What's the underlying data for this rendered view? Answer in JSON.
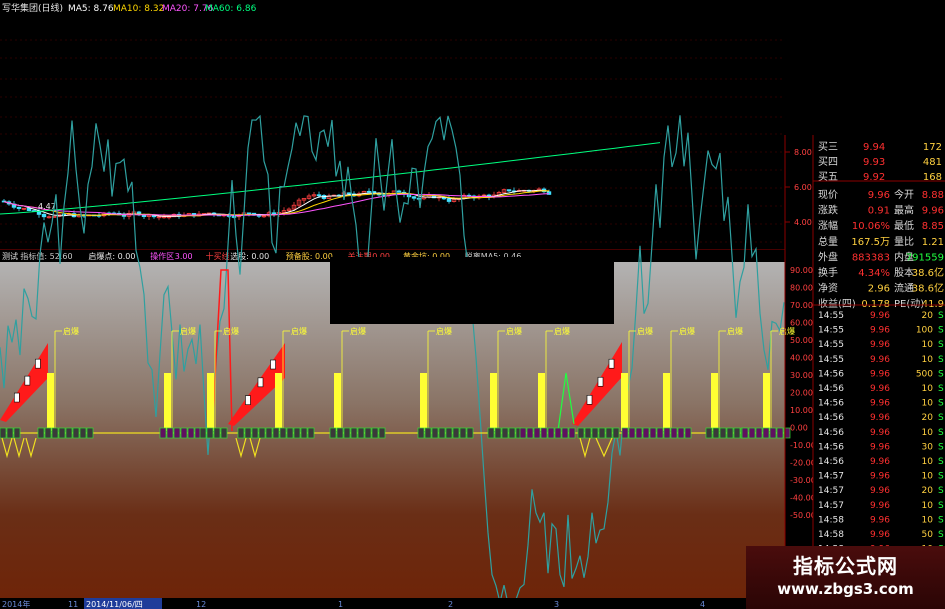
{
  "main_header": {
    "title": "写华集团(日线)",
    "ma5": "MA5: 8.76",
    "ma10": "MA10: 8.32",
    "ma20": "MA20: 7.76",
    "ma60": "MA60: 6.86"
  },
  "price_axis": [
    "8.00",
    "6.00",
    "4.00"
  ],
  "low_label": "4.47",
  "ind_header": [
    {
      "text": "测试",
      "color": "#e6e6e6"
    },
    {
      "text": "指标值: 52.60",
      "color": "#c8c8c8"
    },
    {
      "text": "启爆点: 0.00",
      "color": "#e6e6e6"
    },
    {
      "text": "操作区",
      "color": "#ff55ff"
    },
    {
      "text": "3.00",
      "color": "#ff55ff"
    },
    {
      "text": "十买线",
      "color": "#ff4040"
    },
    {
      "text": "选股: 0.00",
      "color": "#e6e6e6"
    },
    {
      "text": "预备股: 0.00",
      "color": "#ffd040"
    },
    {
      "text": "关注期",
      "color": "#ff4040"
    },
    {
      "text": "0.00",
      "color": "#ff4040"
    },
    {
      "text": "黄金坑: 0.00",
      "color": "#ffd040"
    },
    {
      "text": "脱离MA5: 0.46",
      "color": "#c8c8c8"
    }
  ],
  "ind_axis": [
    "90.00",
    "80.00",
    "70.00",
    "60.00",
    "50.00",
    "40.00",
    "30.00",
    "20.00",
    "10.00",
    "0.00",
    "-10.00",
    "-20.00",
    "-30.00",
    "-40.00",
    "-50.00"
  ],
  "signal_label": "启爆",
  "signal_x": [
    50,
    167,
    210,
    278,
    337,
    423,
    493,
    541,
    624,
    666,
    714,
    766
  ],
  "date_bar": [
    "2014年",
    "11",
    "2014/11/06/四",
    "12",
    "1",
    "2",
    "3",
    "4"
  ],
  "order_book": [
    {
      "label": "买三",
      "price": "9.94",
      "vol": "172"
    },
    {
      "label": "买四",
      "price": "9.93",
      "vol": "481"
    },
    {
      "label": "买五",
      "price": "9.92",
      "vol": "168"
    }
  ],
  "quote_rows": [
    {
      "l": "现价",
      "v": "9.96",
      "r": "今开",
      "rv": "8.88"
    },
    {
      "l": "涨跌",
      "v": "0.91",
      "r": "最高",
      "rv": "9.96"
    },
    {
      "l": "涨幅",
      "v": "10.06%",
      "r": "最低",
      "rv": "8.85"
    },
    {
      "l": "总量",
      "v": "167.5万",
      "r": "量比",
      "rv": "1.21"
    },
    {
      "l": "外盘",
      "v": "883383",
      "r": "内盘",
      "rv": "791559"
    },
    {
      "l": "换手",
      "v": "4.34%",
      "r": "股本",
      "rv": "38.6亿"
    },
    {
      "l": "净资",
      "v": "2.96",
      "r": "流通",
      "rv": "38.6亿"
    },
    {
      "l": "收益(四)",
      "v": "0.178",
      "r": "PE(动)",
      "rv": "41.9"
    }
  ],
  "ticks": [
    {
      "t": "14:55",
      "p": "9.96",
      "v": "20",
      "f": "S"
    },
    {
      "t": "14:55",
      "p": "9.96",
      "v": "100",
      "f": "S"
    },
    {
      "t": "14:55",
      "p": "9.96",
      "v": "10",
      "f": "S"
    },
    {
      "t": "14:55",
      "p": "9.96",
      "v": "10",
      "f": "S"
    },
    {
      "t": "14:56",
      "p": "9.96",
      "v": "500",
      "f": "S"
    },
    {
      "t": "14:56",
      "p": "9.96",
      "v": "10",
      "f": "S"
    },
    {
      "t": "14:56",
      "p": "9.96",
      "v": "10",
      "f": "S"
    },
    {
      "t": "14:56",
      "p": "9.96",
      "v": "20",
      "f": "S"
    },
    {
      "t": "14:56",
      "p": "9.96",
      "v": "10",
      "f": "S"
    },
    {
      "t": "14:56",
      "p": "9.96",
      "v": "30",
      "f": "S"
    },
    {
      "t": "14:56",
      "p": "9.96",
      "v": "10",
      "f": "S"
    },
    {
      "t": "14:57",
      "p": "9.96",
      "v": "10",
      "f": "S"
    },
    {
      "t": "14:57",
      "p": "9.96",
      "v": "20",
      "f": "S"
    },
    {
      "t": "14:57",
      "p": "9.96",
      "v": "10",
      "f": "S"
    },
    {
      "t": "14:58",
      "p": "9.96",
      "v": "10",
      "f": "S"
    },
    {
      "t": "14:58",
      "p": "9.96",
      "v": "50",
      "f": "S"
    },
    {
      "t": "14:58",
      "p": "9.96",
      "v": "10",
      "f": "S"
    },
    {
      "t": "14:58",
      "p": "9.96",
      "v": "20",
      "f": "S"
    }
  ],
  "watermark": {
    "line1": "指标公式网",
    "line2": "www.zbgs3.com"
  },
  "colors": {
    "rise": "#ff3030",
    "text": "#d8d8d8",
    "up_candle": "#ff4040",
    "down_candle": "#40e0ff",
    "ma5": "#ffffff",
    "ma10": "#ffd700",
    "ma20": "#ff55ff",
    "ma60": "#00ff80",
    "signal_bar": "#ffff33",
    "osc_line": "#2fa0a0",
    "panel_border": "#8b0000"
  }
}
